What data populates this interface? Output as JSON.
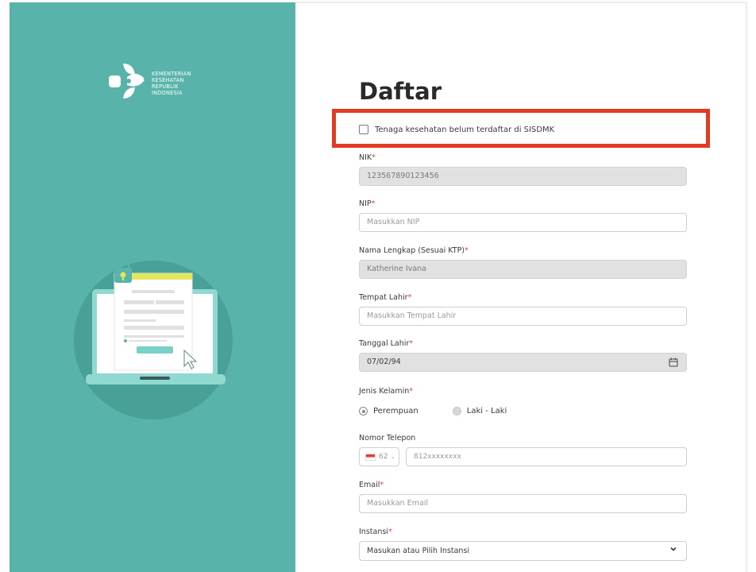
{
  "brand": {
    "lines": [
      "KEMENTERIAN",
      "KESEHATAN",
      "REPUBLIK",
      "INDONESIA"
    ]
  },
  "form": {
    "title": "Daftar",
    "checkbox_label": "Tenaga kesehatan belum terdaftar di SISDMK",
    "nik": {
      "label": "NIK",
      "value": "123567890123456"
    },
    "nip": {
      "label": "NIP",
      "placeholder": "Masukkan NIP"
    },
    "nama": {
      "label": "Nama Lengkap (Sesuai KTP)",
      "value": "Katherine Ivana"
    },
    "tempat_lahir": {
      "label": "Tempat Lahir",
      "placeholder": "Masukkan Tempat Lahir"
    },
    "tanggal_lahir": {
      "label": "Tanggal Lahir",
      "value": "07/02/94"
    },
    "jenis_kelamin": {
      "label": "Jenis Kelamin",
      "options": [
        "Perempuan",
        "Laki - Laki"
      ],
      "selected": "Perempuan"
    },
    "telepon": {
      "label": "Nomor Telepon",
      "code": "62",
      "placeholder": "812xxxxxxxx"
    },
    "email": {
      "label": "Email",
      "placeholder": "Masukkan Email"
    },
    "instansi": {
      "label": "Instansi",
      "placeholder": "Masukan atau Pilih Instansi"
    },
    "required_mark": "*"
  },
  "colors": {
    "panel": "#58b3aa",
    "highlight": "#e23b22",
    "required": "#e0453a"
  },
  "icons": [
    "kemenkes-logo",
    "checkbox-icon",
    "calendar-icon",
    "flag-indonesia-icon",
    "chevron-down-icon",
    "laptop-illustration",
    "lock-icon",
    "cursor-icon"
  ]
}
